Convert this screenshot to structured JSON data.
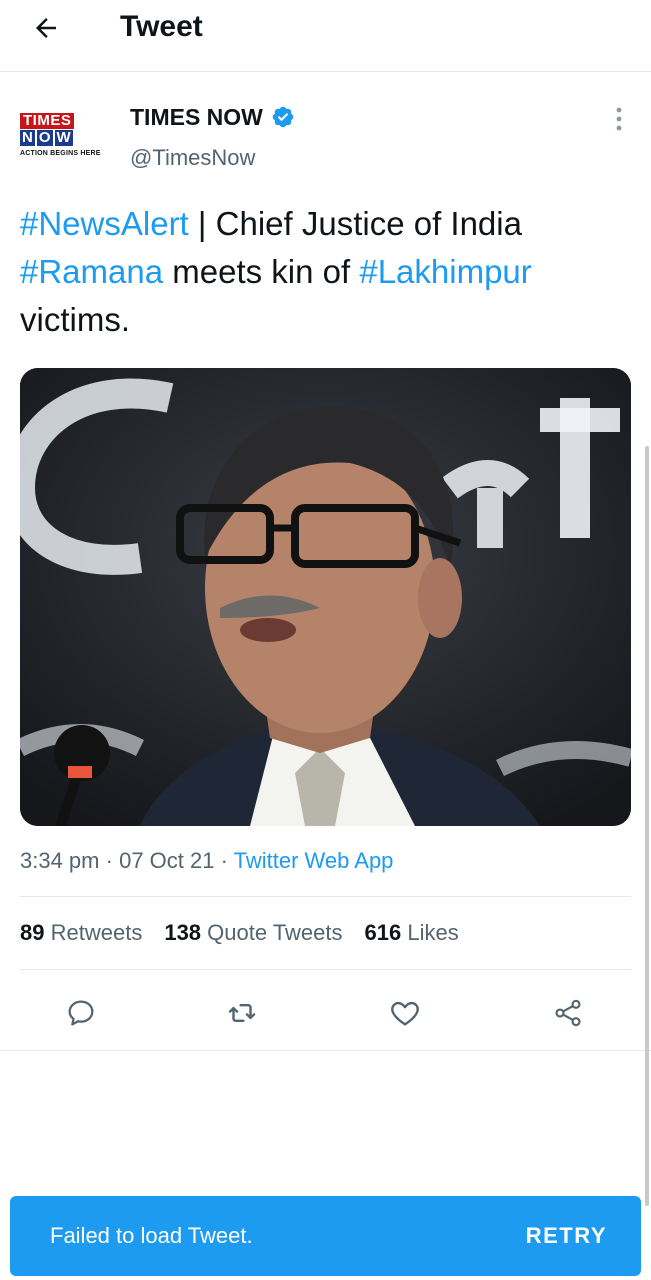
{
  "header": {
    "title": "Tweet",
    "back_icon": "arrow-left-icon"
  },
  "author": {
    "name": "TIMES NOW",
    "handle": "@TimesNow",
    "verified": true,
    "avatar_logo": {
      "line1": "TIMES",
      "line2": [
        "N",
        "O",
        "W"
      ],
      "tagline": "ACTION BEGINS HERE"
    },
    "more_icon": "more-vertical-icon"
  },
  "tweet": {
    "text_parts": [
      {
        "type": "hashtag",
        "text": "#NewsAlert"
      },
      {
        "type": "text",
        "text": " | Chief Justice of India "
      },
      {
        "type": "hashtag",
        "text": "#Ramana"
      },
      {
        "type": "text",
        "text": " meets kin of "
      },
      {
        "type": "hashtag",
        "text": "#Lakhimpur"
      },
      {
        "type": "text",
        "text": " victims."
      }
    ]
  },
  "meta": {
    "time": "3:34 pm",
    "separator": "·",
    "date": "07 Oct 21",
    "source": "Twitter Web App"
  },
  "stats": {
    "retweets_count": "89",
    "retweets_label": "Retweets",
    "quotes_count": "138",
    "quotes_label": "Quote Tweets",
    "likes_count": "616",
    "likes_label": "Likes"
  },
  "actions": {
    "reply_icon": "reply-icon",
    "retweet_icon": "retweet-icon",
    "like_icon": "heart-icon",
    "share_icon": "share-icon"
  },
  "snackbar": {
    "message": "Failed to load Tweet.",
    "action": "RETRY"
  },
  "colors": {
    "accent": "#1d9bf0",
    "text_primary": "#0f1419",
    "text_secondary": "#536471",
    "divider": "#e6e9eb"
  }
}
